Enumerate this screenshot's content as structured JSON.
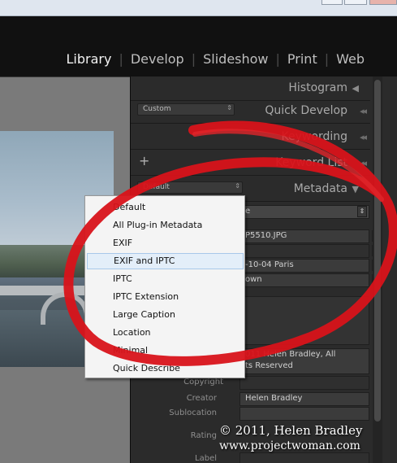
{
  "modules": [
    {
      "label": "Library",
      "active": true
    },
    {
      "label": "Develop",
      "active": false
    },
    {
      "label": "Slideshow",
      "active": false
    },
    {
      "label": "Print",
      "active": false
    },
    {
      "label": "Web",
      "active": false
    }
  ],
  "panels": {
    "histogram": "Histogram",
    "quick_develop": "Quick Develop",
    "quick_develop_preset": "Custom",
    "keywording": "Keywording",
    "keyword_list": "Keyword List",
    "metadata": "Metadata",
    "metadata_preset": "Default"
  },
  "metadata_fields": {
    "filename_partial": "P5510.JPG",
    "caption_partial": "-10-04 Paris",
    "copyright_partial": "own",
    "copyright_line1": "011 Helen Bradley, All",
    "copyright_line2": "ts Reserved",
    "copyright_label": "Copyright",
    "creator_label": "Creator",
    "creator_value": "Helen Bradley",
    "sublocation_label": "Sublocation",
    "rating_label": "Rating",
    "label_label": "Label"
  },
  "dropdown": {
    "items": [
      "Default",
      "All Plug-in Metadata",
      "EXIF",
      "EXIF and IPTC",
      "IPTC",
      "IPTC Extension",
      "Large Caption",
      "Location",
      "Minimal",
      "Quick Describe"
    ],
    "highlighted_index": 3
  },
  "watermark": {
    "line1": "© 2011, Helen Bradley",
    "line2": "www.projectwoman.com"
  },
  "colors": {
    "annotation_red": "#d8131a",
    "menu_highlight": "#e3eef9"
  }
}
